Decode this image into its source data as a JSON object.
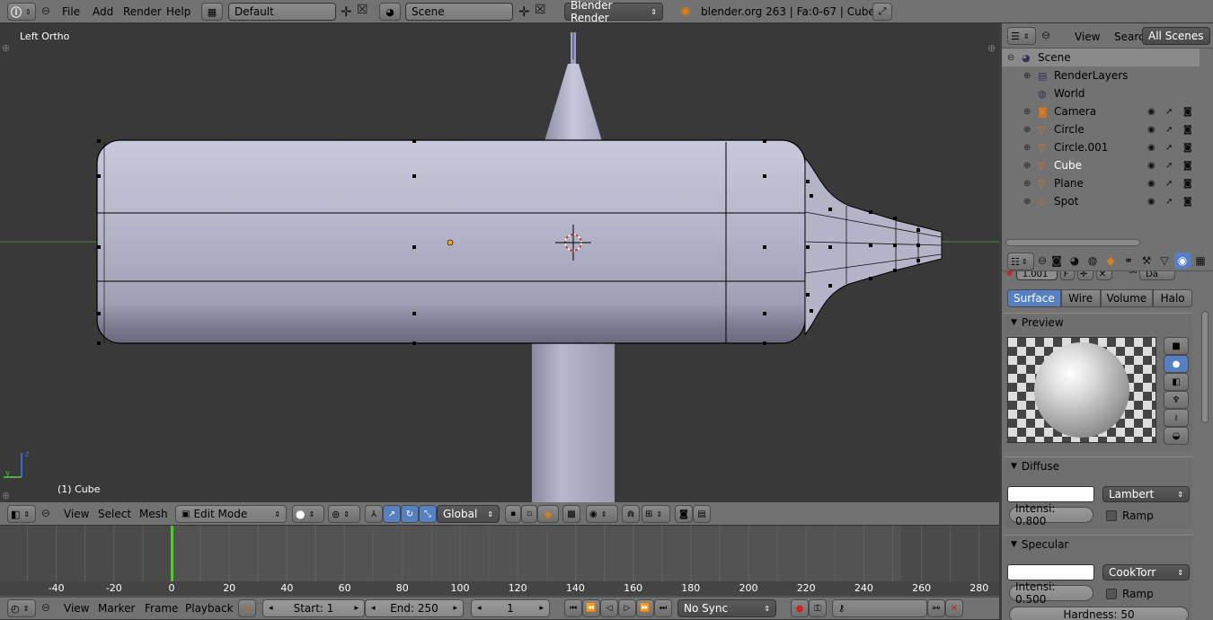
{
  "top_bar": {
    "menus": [
      "File",
      "Add",
      "Render",
      "Help"
    ],
    "screen_layout": "Default",
    "scene": "Scene",
    "render_engine": "Blender Render",
    "status": "blender.org 263 | Fa:0-67 | Cube"
  },
  "viewport": {
    "view_label": "Left Ortho",
    "object_label": "(1) Cube"
  },
  "view3d_header": {
    "menus": [
      "View",
      "Select",
      "Mesh"
    ],
    "mode": "Edit Mode",
    "orientation": "Global"
  },
  "outliner": {
    "header_menus": [
      "View",
      "Search"
    ],
    "display_mode": "All Scenes",
    "items": [
      {
        "label": "Scene",
        "icon": "scene-icon"
      },
      {
        "label": "RenderLayers",
        "icon": "render-layers-icon"
      },
      {
        "label": "World",
        "icon": "world-icon"
      },
      {
        "label": "Camera",
        "icon": "camera-icon"
      },
      {
        "label": "Circle",
        "icon": "mesh-icon"
      },
      {
        "label": "Circle.001",
        "icon": "mesh-icon"
      },
      {
        "label": "Cube",
        "icon": "mesh-icon"
      },
      {
        "label": "Plane",
        "icon": "mesh-icon"
      },
      {
        "label": "Spot",
        "icon": "lamp-icon"
      }
    ]
  },
  "properties": {
    "material_name": "1.001",
    "material_flag": "F",
    "data_tail": "Da",
    "tabs": [
      "Surface",
      "Wire",
      "Volume",
      "Halo"
    ],
    "active_tab": "Surface",
    "preview_title": "Preview",
    "diffuse_title": "Diffuse",
    "diffuse_shader": "Lambert",
    "diffuse_intensity": "Intensi: 0.800",
    "ramp_label": "Ramp",
    "specular_title": "Specular",
    "specular_shader": "CookTorr",
    "specular_intensity": "Intensi: 0.500",
    "hardness": "Hardness: 50"
  },
  "timeline": {
    "ticks": [
      "-40",
      "-20",
      "0",
      "20",
      "40",
      "60",
      "80",
      "100",
      "120",
      "140",
      "160",
      "180",
      "200",
      "220",
      "240",
      "260",
      "280"
    ],
    "menus": [
      "View",
      "Marker",
      "Frame",
      "Playback"
    ],
    "start": "Start: 1",
    "end": "End: 250",
    "current_frame": "1",
    "sync": "No Sync"
  },
  "colors": {
    "accent": "#5680c2",
    "header_bg": "#727272",
    "viewport_bg": "#393939",
    "current_frame_line": "#60c040"
  }
}
